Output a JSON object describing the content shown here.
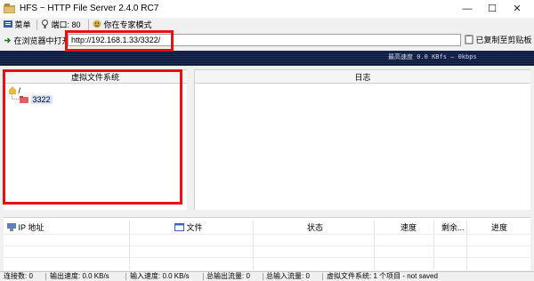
{
  "window": {
    "title": "HFS ~ HTTP File Server 2.4.0 RC7",
    "minimize_icon": "minimize-icon",
    "maximize_icon": "maximize-icon",
    "close_icon": "close-icon"
  },
  "toolbar": {
    "menu_label": "菜单",
    "port_label": "端口: 80",
    "mode_label": "你在专家模式"
  },
  "address": {
    "open_in_browser_label": "在浏览器中打开",
    "url_value": "http://192.168.1.33/3322/",
    "copy_label": "已复制至剪贴板"
  },
  "speed": {
    "text": "最高速度 0.0 KBfs  —  0kbps"
  },
  "vfs": {
    "header": "虚拟文件系统",
    "root_label": "/",
    "child_label": "3322"
  },
  "log": {
    "header": "日志"
  },
  "connections": {
    "columns": [
      "IP 地址",
      "文件",
      "状态",
      "速度",
      "剩余...",
      "进度"
    ]
  },
  "statusbar": {
    "connections": "连接数: 0",
    "out_speed": "输出速度: 0.0 KB/s",
    "in_speed": "输入速度: 0.0 KB/s",
    "total_out": "总输出流量: 0",
    "total_in": "总输入流量: 0",
    "vfs_info": "虚拟文件系统: 1 个项目 - not saved"
  },
  "colors": {
    "highlight": "#e81010",
    "strip_bg": "#0a1433"
  }
}
